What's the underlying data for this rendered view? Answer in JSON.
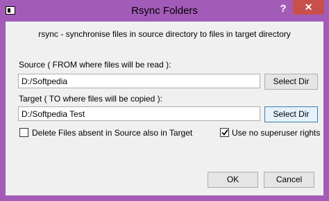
{
  "window": {
    "title": "Rsync Folders",
    "help_glyph": "?",
    "close_glyph": "✕"
  },
  "header": {
    "text": "rsync - synchronise files in source directory to files in target directory"
  },
  "source": {
    "label": "Source ( FROM where files will be read ):",
    "value": "D:/Softpedia",
    "button_label": "Select Dir"
  },
  "target": {
    "label": "Target ( TO where files will be copied ):",
    "value": "D:/Softpedia Test",
    "button_label": "Select Dir"
  },
  "options": {
    "delete_label": "Delete Files absent in Source also in Target",
    "delete_checked": false,
    "superuser_label": "Use no superuser rights",
    "superuser_checked": true
  },
  "footer": {
    "ok_label": "OK",
    "cancel_label": "Cancel"
  }
}
